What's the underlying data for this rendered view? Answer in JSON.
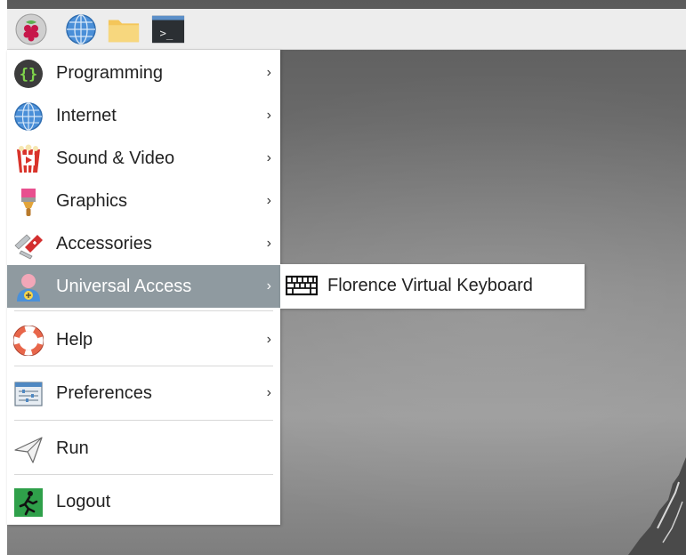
{
  "taskbar": {
    "launchers": [
      {
        "name": "raspberry-menu",
        "icon": "raspberry-icon"
      },
      {
        "name": "web-browser",
        "icon": "globe-icon"
      },
      {
        "name": "file-manager",
        "icon": "folder-icon"
      },
      {
        "name": "terminal",
        "icon": "terminal-icon"
      }
    ],
    "terminal_prompt": ">_"
  },
  "menu": {
    "items": [
      {
        "label": "Programming",
        "icon": "programming-braces-icon",
        "submenu": true
      },
      {
        "label": "Internet",
        "icon": "globe-icon",
        "submenu": true
      },
      {
        "label": "Sound & Video",
        "icon": "popcorn-film-icon",
        "submenu": true
      },
      {
        "label": "Graphics",
        "icon": "paintbrush-icon",
        "submenu": true
      },
      {
        "label": "Accessories",
        "icon": "swiss-knife-icon",
        "submenu": true
      },
      {
        "label": "Universal Access",
        "icon": "accessibility-person-icon",
        "submenu": true,
        "selected": true
      },
      {
        "label": "Help",
        "icon": "lifebuoy-icon",
        "submenu": true
      },
      {
        "label": "Preferences",
        "icon": "preferences-panel-icon",
        "submenu": true
      },
      {
        "label": "Run",
        "icon": "paper-plane-icon",
        "submenu": false
      },
      {
        "label": "Logout",
        "icon": "running-man-exit-icon",
        "submenu": false
      }
    ],
    "chevron": "›"
  },
  "submenu": {
    "items": [
      {
        "label": "Florence Virtual Keyboard",
        "icon": "keyboard-icon"
      }
    ]
  },
  "colors": {
    "selected_bg": "#8f9aa0",
    "taskbar_bg": "#ededed",
    "menu_bg": "#ffffff"
  }
}
